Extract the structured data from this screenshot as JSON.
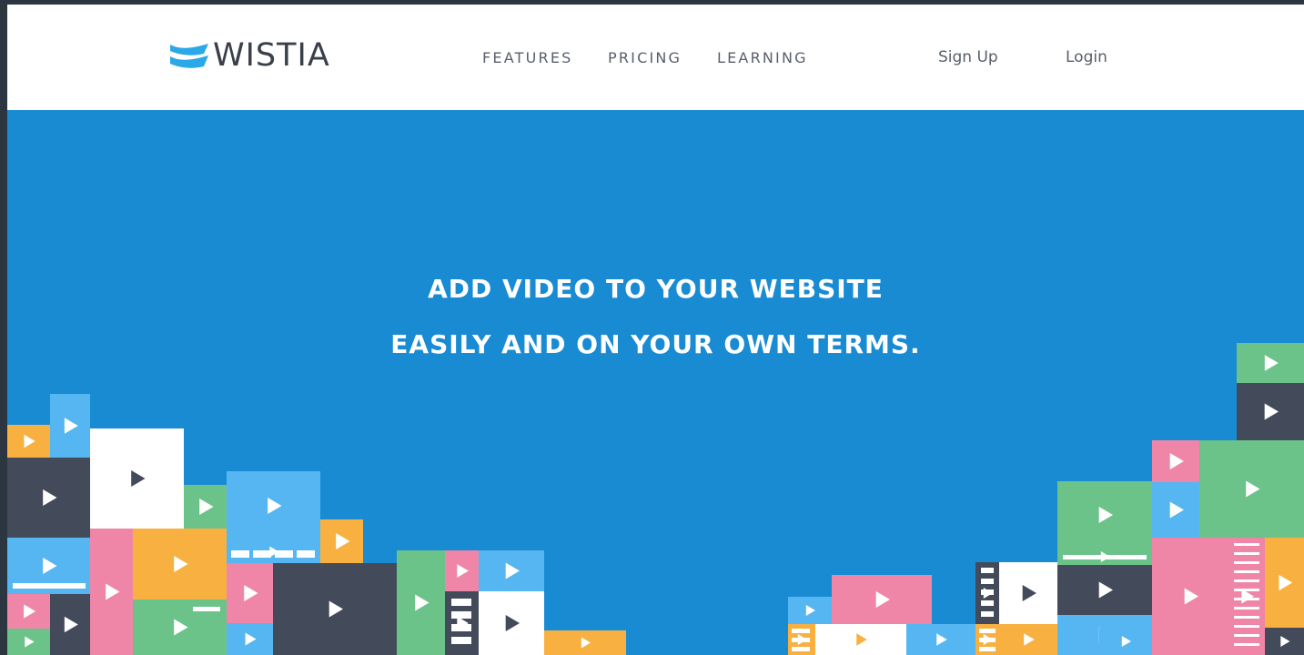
{
  "brand": {
    "name": "WISTIA",
    "mark_color": "#2aa8e8",
    "text_color": "#3a3f4a"
  },
  "nav": [
    {
      "label": "FEATURES"
    },
    {
      "label": "PRICING"
    },
    {
      "label": "LEARNING"
    }
  ],
  "auth": {
    "signup": "Sign Up",
    "login": "Login"
  },
  "hero": {
    "line1": "ADD VIDEO TO YOUR WEBSITE",
    "line2": "EASILY AND ON YOUR OWN TERMS.",
    "background": "#188bd3"
  },
  "palette": {
    "green": "#6cc38a",
    "pink": "#ef86a8",
    "orange": "#f8b140",
    "dark": "#434a5a",
    "white": "#ffffff",
    "light_blue": "#55b6f2"
  },
  "decoration": {
    "icon": "play-icon"
  }
}
